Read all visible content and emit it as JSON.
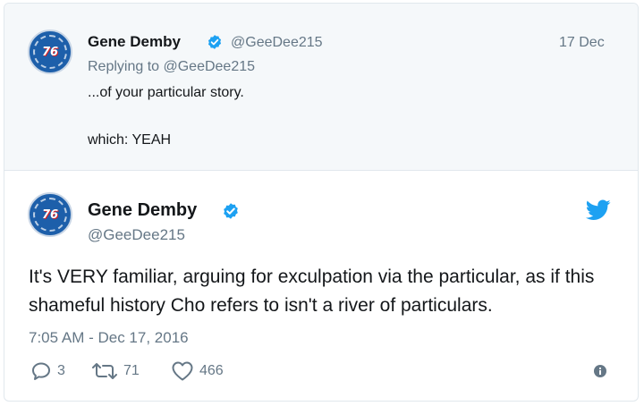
{
  "parent_tweet": {
    "name": "Gene Demby",
    "handle": "@GeeDee215",
    "date": "17 Dec",
    "replying_to": "Replying to @GeeDee215",
    "text_line1": "...of your particular story.",
    "text_line2": "which: YEAH"
  },
  "main_tweet": {
    "name": "Gene Demby",
    "handle": "@GeeDee215",
    "text": "It's VERY familiar, arguing for exculpation via the particular, as if this shameful history Cho refers to isn't a river of particulars.",
    "timestamp": "7:05 AM - Dec 17, 2016",
    "replies": "3",
    "retweets": "71",
    "likes": "466"
  },
  "avatar": {
    "logo_text": "76"
  },
  "colors": {
    "verified": "#1da1f2",
    "twitter_brand": "#1da1f2",
    "muted": "#657786",
    "parent_background": "#f5f8fa"
  },
  "icons": [
    "verified-icon",
    "twitter-bird-icon",
    "reply-icon",
    "retweet-icon",
    "like-icon",
    "info-icon"
  ]
}
